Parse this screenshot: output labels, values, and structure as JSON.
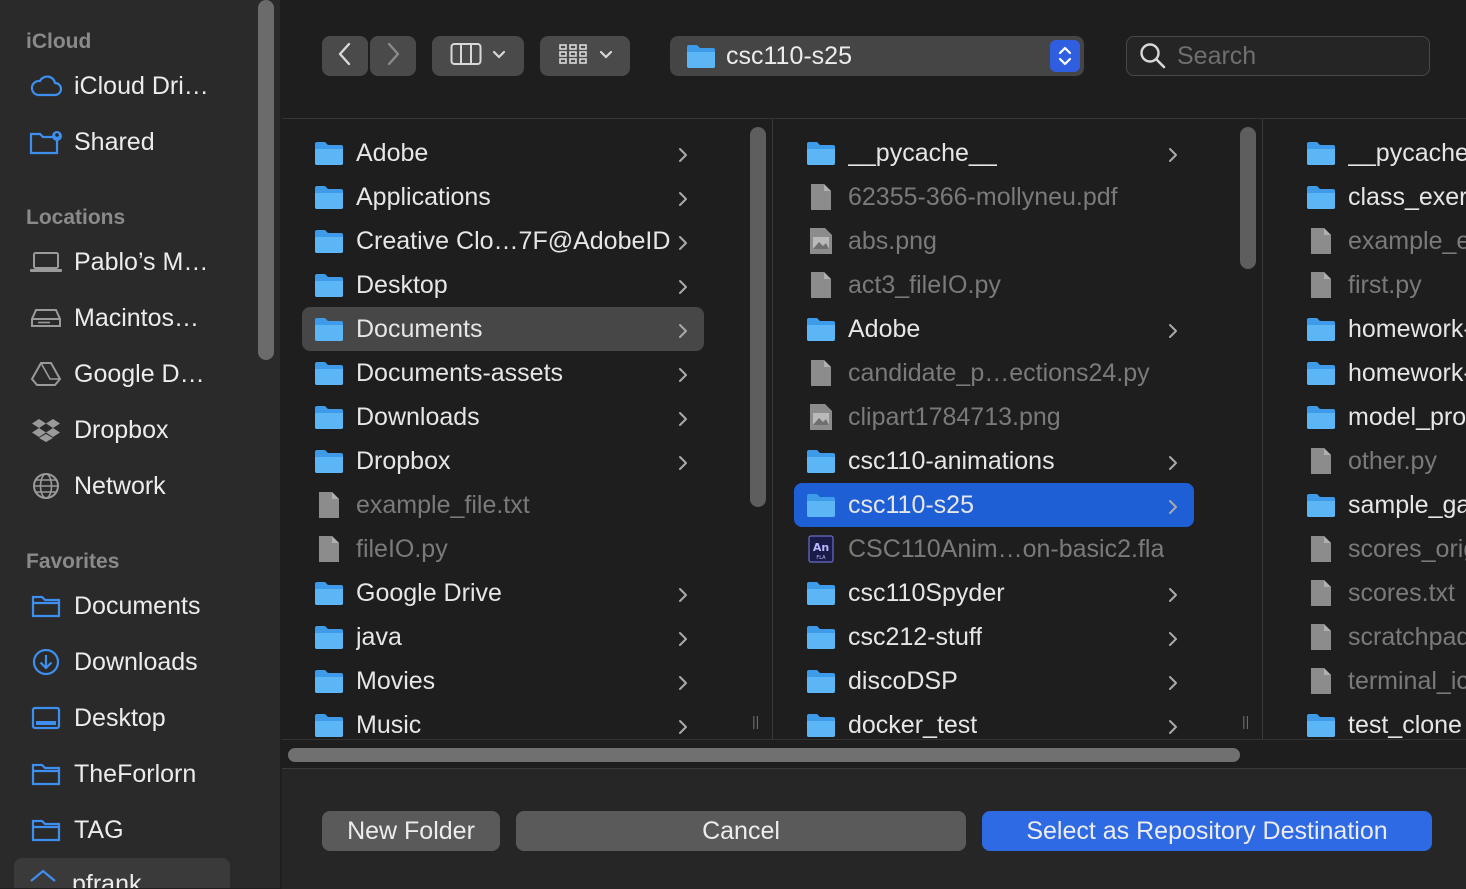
{
  "sidebar": {
    "sections": {
      "icloud": "iCloud",
      "locations": "Locations",
      "favorites": "Favorites"
    },
    "icloud_items": [
      {
        "label": "iCloud Dri…",
        "icon": "cloud-icon"
      },
      {
        "label": "Shared",
        "icon": "shared-folder-icon"
      }
    ],
    "location_items": [
      {
        "label": "Pablo’s M…",
        "icon": "laptop-icon"
      },
      {
        "label": "Macintos…",
        "icon": "hard-drive-icon"
      },
      {
        "label": "Google D…",
        "icon": "google-drive-icon"
      },
      {
        "label": "Dropbox",
        "icon": "dropbox-icon"
      },
      {
        "label": "Network",
        "icon": "globe-icon"
      }
    ],
    "favorite_items": [
      {
        "label": "Documents",
        "icon": "folder-icon"
      },
      {
        "label": "Downloads",
        "icon": "download-icon"
      },
      {
        "label": "Desktop",
        "icon": "desktop-icon"
      },
      {
        "label": "TheForlorn",
        "icon": "folder-icon"
      },
      {
        "label": "TAG",
        "icon": "folder-icon"
      }
    ],
    "user_item": {
      "label": "pfrank",
      "icon": "home-icon"
    }
  },
  "toolbar": {
    "path_value": "csc110-s25",
    "search_placeholder": "Search"
  },
  "columns": [
    {
      "items": [
        {
          "name": "Adobe",
          "kind": "folder",
          "chevron": true
        },
        {
          "name": "Applications",
          "kind": "folder",
          "chevron": true
        },
        {
          "name": "Creative Clo…7F@AdobeID",
          "kind": "folder",
          "chevron": true
        },
        {
          "name": "Desktop",
          "kind": "folder",
          "chevron": true
        },
        {
          "name": "Documents",
          "kind": "folder",
          "chevron": true,
          "selected": "gray"
        },
        {
          "name": "Documents-assets",
          "kind": "folder",
          "chevron": true
        },
        {
          "name": "Downloads",
          "kind": "folder",
          "chevron": true
        },
        {
          "name": "Dropbox",
          "kind": "folder",
          "chevron": true
        },
        {
          "name": "example_file.txt",
          "kind": "file",
          "dim": true
        },
        {
          "name": "fileIO.py",
          "kind": "file",
          "dim": true
        },
        {
          "name": "Google Drive",
          "kind": "folder",
          "chevron": true
        },
        {
          "name": "java",
          "kind": "folder",
          "chevron": true
        },
        {
          "name": "Movies",
          "kind": "folder",
          "chevron": true
        },
        {
          "name": "Music",
          "kind": "folder",
          "chevron": true
        }
      ]
    },
    {
      "items": [
        {
          "name": "__pycache__",
          "kind": "folder",
          "chevron": true
        },
        {
          "name": "62355-366-mollyneu.pdf",
          "kind": "file",
          "dim": true
        },
        {
          "name": "abs.png",
          "kind": "image",
          "dim": true
        },
        {
          "name": "act3_fileIO.py",
          "kind": "file",
          "dim": true
        },
        {
          "name": "Adobe",
          "kind": "folder",
          "chevron": true
        },
        {
          "name": "candidate_p…ections24.py",
          "kind": "file",
          "dim": true
        },
        {
          "name": "clipart1784713.png",
          "kind": "image",
          "dim": true
        },
        {
          "name": "csc110-animations",
          "kind": "folder",
          "chevron": true
        },
        {
          "name": "csc110-s25",
          "kind": "folder",
          "chevron": true,
          "selected": "blue"
        },
        {
          "name": "CSC110Anim…on-basic2.fla",
          "kind": "animate",
          "dim": true
        },
        {
          "name": "csc110Spyder",
          "kind": "folder",
          "chevron": true
        },
        {
          "name": "csc212-stuff",
          "kind": "folder",
          "chevron": true
        },
        {
          "name": "discoDSP",
          "kind": "folder",
          "chevron": true
        },
        {
          "name": "docker_test",
          "kind": "folder",
          "chevron": true
        }
      ]
    },
    {
      "items": [
        {
          "name": "__pycache",
          "kind": "folder"
        },
        {
          "name": "class_exerc",
          "kind": "folder"
        },
        {
          "name": "example_e",
          "kind": "file",
          "dim": true
        },
        {
          "name": "first.py",
          "kind": "file",
          "dim": true
        },
        {
          "name": "homework-",
          "kind": "folder"
        },
        {
          "name": "homework-",
          "kind": "folder"
        },
        {
          "name": "model_pro",
          "kind": "folder"
        },
        {
          "name": "other.py",
          "kind": "file",
          "dim": true
        },
        {
          "name": "sample_ga",
          "kind": "folder"
        },
        {
          "name": "scores_orig",
          "kind": "file",
          "dim": true
        },
        {
          "name": "scores.txt",
          "kind": "file",
          "dim": true
        },
        {
          "name": "scratchpad",
          "kind": "file",
          "dim": true
        },
        {
          "name": "terminal_ic",
          "kind": "file",
          "dim": true
        },
        {
          "name": "test_clone",
          "kind": "folder"
        }
      ]
    }
  ],
  "footer": {
    "new_folder": "New Folder",
    "cancel": "Cancel",
    "select": "Select as Repository Destination"
  },
  "colors": {
    "accent": "#2e6ae3",
    "selection_blue": "#1f5fd6",
    "folder_blue": "#4fb0f5",
    "sidebar_icon_blue": "#3d8ff0"
  }
}
